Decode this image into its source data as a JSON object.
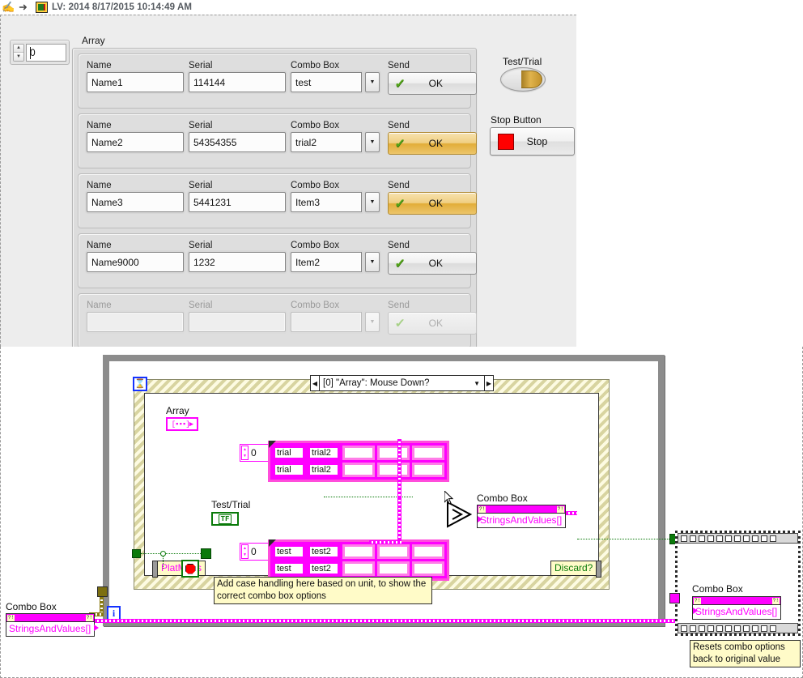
{
  "titlebar": {
    "hand_icon": "hand-icon",
    "arrow_icon": "arrow-right-icon",
    "vi_icon": "labview-vi-icon",
    "title": "LV: 2014 8/17/2015 10:14:49 AM"
  },
  "front_panel": {
    "index_control": {
      "value": "0",
      "name": "array-index"
    },
    "array_label": "Array",
    "column_headers": {
      "name": "Name",
      "serial": "Serial",
      "combo": "Combo Box",
      "send": "Send"
    },
    "ok_label": "OK",
    "rows": [
      {
        "name": "Name1",
        "serial": "114144",
        "combo": "test",
        "ok": "OK",
        "highlighted": false,
        "disabled": false
      },
      {
        "name": "Name2",
        "serial": "54354355",
        "combo": "trial2",
        "ok": "OK",
        "highlighted": true,
        "disabled": false
      },
      {
        "name": "Name3",
        "serial": "5441231",
        "combo": "Item3",
        "ok": "OK",
        "highlighted": true,
        "disabled": false
      },
      {
        "name": "Name9000",
        "serial": "1232",
        "combo": "Item2",
        "ok": "OK",
        "highlighted": false,
        "disabled": false
      },
      {
        "name": "",
        "serial": "",
        "combo": "",
        "ok": "OK",
        "highlighted": false,
        "disabled": true
      }
    ],
    "test_trial": {
      "label": "Test/Trial",
      "state": "on"
    },
    "stop": {
      "label": "Stop Button",
      "button_label": "Stop",
      "color": "#ff0000"
    }
  },
  "block_diagram": {
    "event_structure": {
      "case_label": "[0] \"Array\": Mouse Down?",
      "hourglass_icon": "timeout-hourglass-icon",
      "left_arrow_icon": "prev-case-icon",
      "right_arrow_icon": "next-case-icon",
      "dropdown_icon": "chevron-down-icon"
    },
    "array_terminal_label": "Array",
    "test_trial_terminal_label": "Test/Trial",
    "test_trial_terminal_text": "TF",
    "trial_array": {
      "index": "0",
      "cells": [
        [
          "trial",
          "trial"
        ],
        [
          "trial2",
          "trial2"
        ],
        [
          "",
          ""
        ],
        [
          "",
          ""
        ],
        [
          "",
          ""
        ]
      ]
    },
    "test_array": {
      "index": "0",
      "cells": [
        [
          "test",
          "test"
        ],
        [
          "test2",
          "test2"
        ],
        [
          "",
          ""
        ],
        [
          "",
          ""
        ],
        [
          "",
          ""
        ]
      ]
    },
    "combo_box_indicator_inner": {
      "label": "Combo Box",
      "text": "StringsAndValues[]"
    },
    "combo_box_terminal_left": {
      "label": "Combo Box",
      "text": "StringsAndValues[]"
    },
    "combo_box_terminal_right": {
      "label": "Combo Box",
      "text": "StringsAndValues[]"
    },
    "comment_case_handling": "Add case handling here based on unit, to show the\ncorrect combo box options",
    "comment_reset": "Resets combo options\nback to original value",
    "platmods_label": "PlatMods",
    "discard_label": "Discard?",
    "iteration_terminal": "i",
    "select_node_icon": "select-node-icon",
    "stop_terminal_icon": "stop-sign-icon"
  },
  "colors": {
    "magenta": "#ff00ff",
    "green": "#0a7a0a",
    "blue": "#1432ff",
    "highlight_amber": "#e2ad38",
    "stop_red": "#ff0000",
    "panel_gray": "#ededed",
    "loop_gray": "#8c8c8c"
  }
}
